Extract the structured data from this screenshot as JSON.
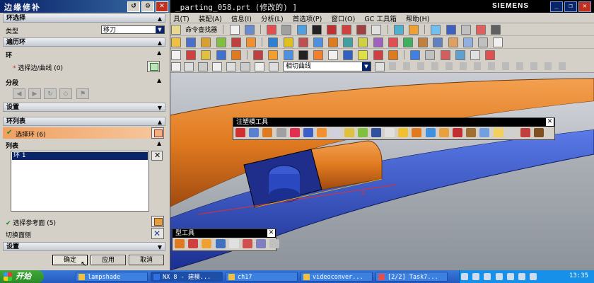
{
  "nx": {
    "window_title": "_parting_058.prt  (修改的)  ]",
    "brand": "SIEMENS",
    "menu": [
      "具(T)",
      "装配(A)",
      "信息(I)",
      "分析(L)",
      "首选项(P)",
      "窗口(O)",
      "GC 工具箱",
      "帮助(H)"
    ],
    "toolbar_label": "命令查找器",
    "curve_rule": "相切曲线"
  },
  "dialog": {
    "title": "边缘修补",
    "sections": {
      "loop_select": "环选择",
      "traverse": "遍历环",
      "loop": "环",
      "segment": "分段",
      "settings1": "设置",
      "loop_list": "环列表",
      "list": "列表",
      "settings2": "设置"
    },
    "type_label": "类型",
    "type_value": "移刀",
    "select_edge": "选择边/曲线 (0)",
    "select_loop": "选择环 (6)",
    "list_item": "环 1",
    "select_ref_face": "选择参考面 (5)",
    "toggle_face_side": "切换面侧",
    "buttons": {
      "ok": "确定",
      "apply": "应用",
      "cancel": "取消"
    }
  },
  "floating_toolbars": {
    "mold_tools": "注塑模工具",
    "mold_tools2": "型工具"
  },
  "taskbar": {
    "start": "开始",
    "tasks": [
      "lampshade",
      "NX 8 - 建模...",
      "ch17",
      "videoconver...",
      "[2/2] Task7..."
    ],
    "clock": "13:35"
  },
  "colors": {
    "accent": "#0a246a",
    "part_orange": "#e07a20",
    "part_blue": "#2a4fc8",
    "dialog_bg": "#d4d0c8"
  }
}
